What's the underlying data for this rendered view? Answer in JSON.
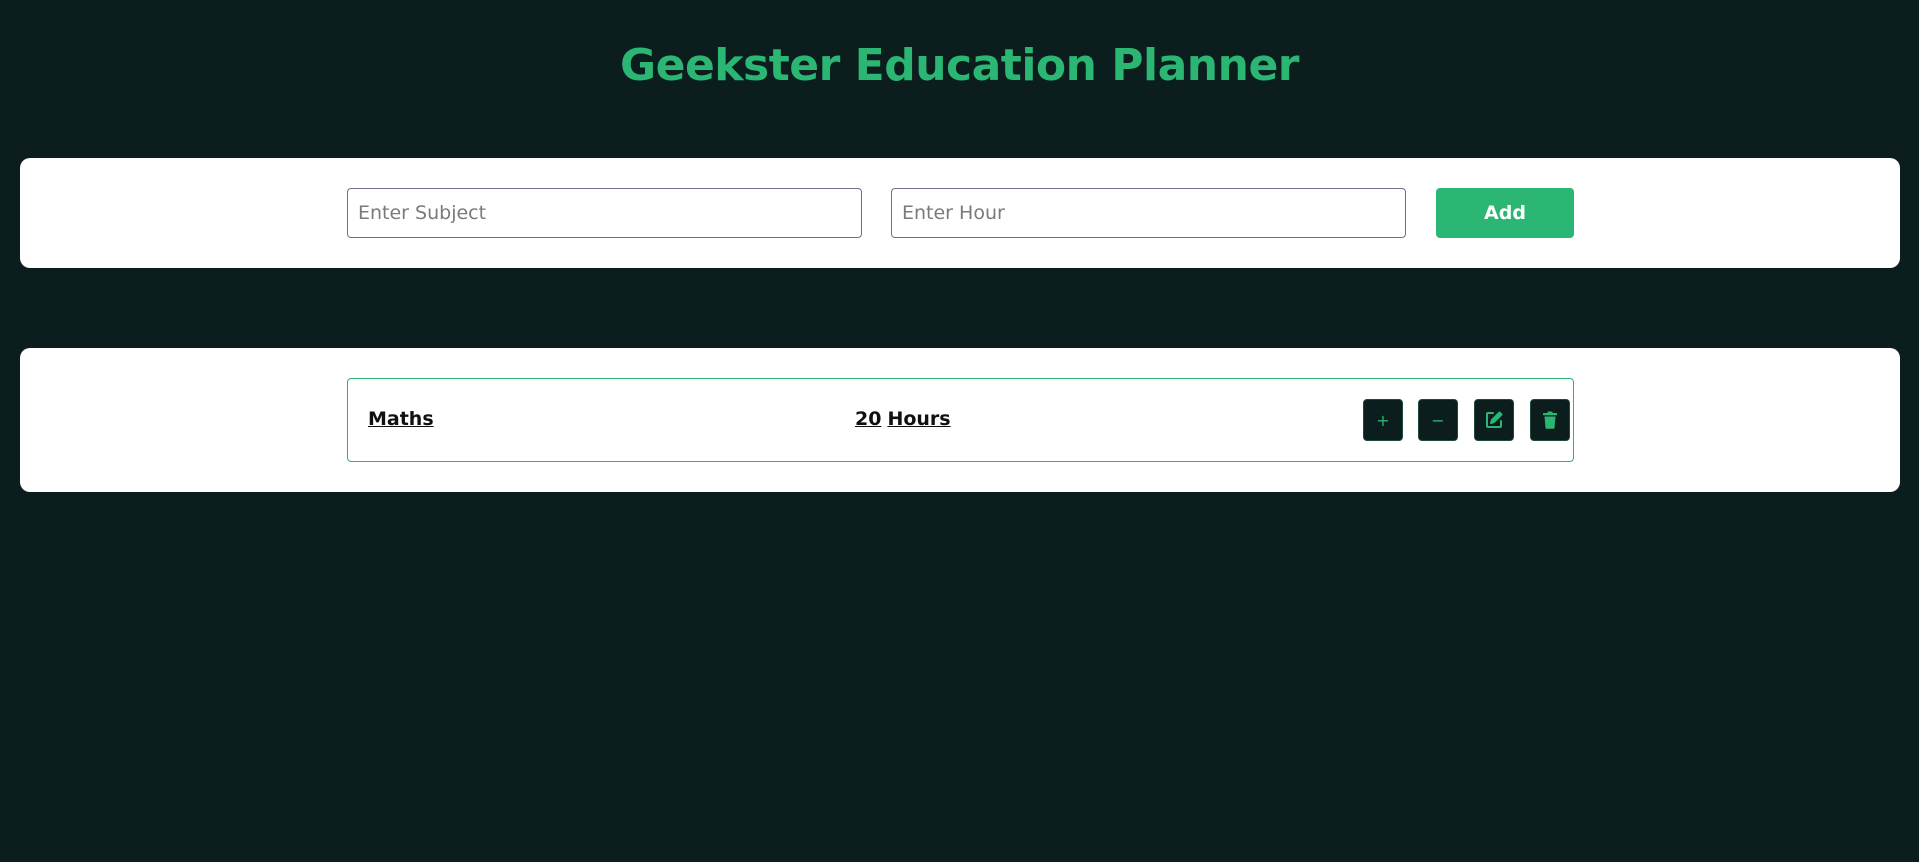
{
  "header": {
    "title": "Geekster Education Planner"
  },
  "form": {
    "subject_placeholder": "Enter Subject",
    "hour_placeholder": "Enter Hour",
    "add_label": "Add"
  },
  "planner": {
    "items": [
      {
        "subject": "Maths",
        "hours": "20",
        "hours_unit": "Hours",
        "actions": {
          "increase_label": "+",
          "decrease_label": "−",
          "edit_icon": "edit-icon",
          "delete_icon": "trash-icon"
        }
      }
    ]
  },
  "colors": {
    "background": "#0c1d1d",
    "accent": "#2bb673",
    "panel": "#ffffff"
  }
}
